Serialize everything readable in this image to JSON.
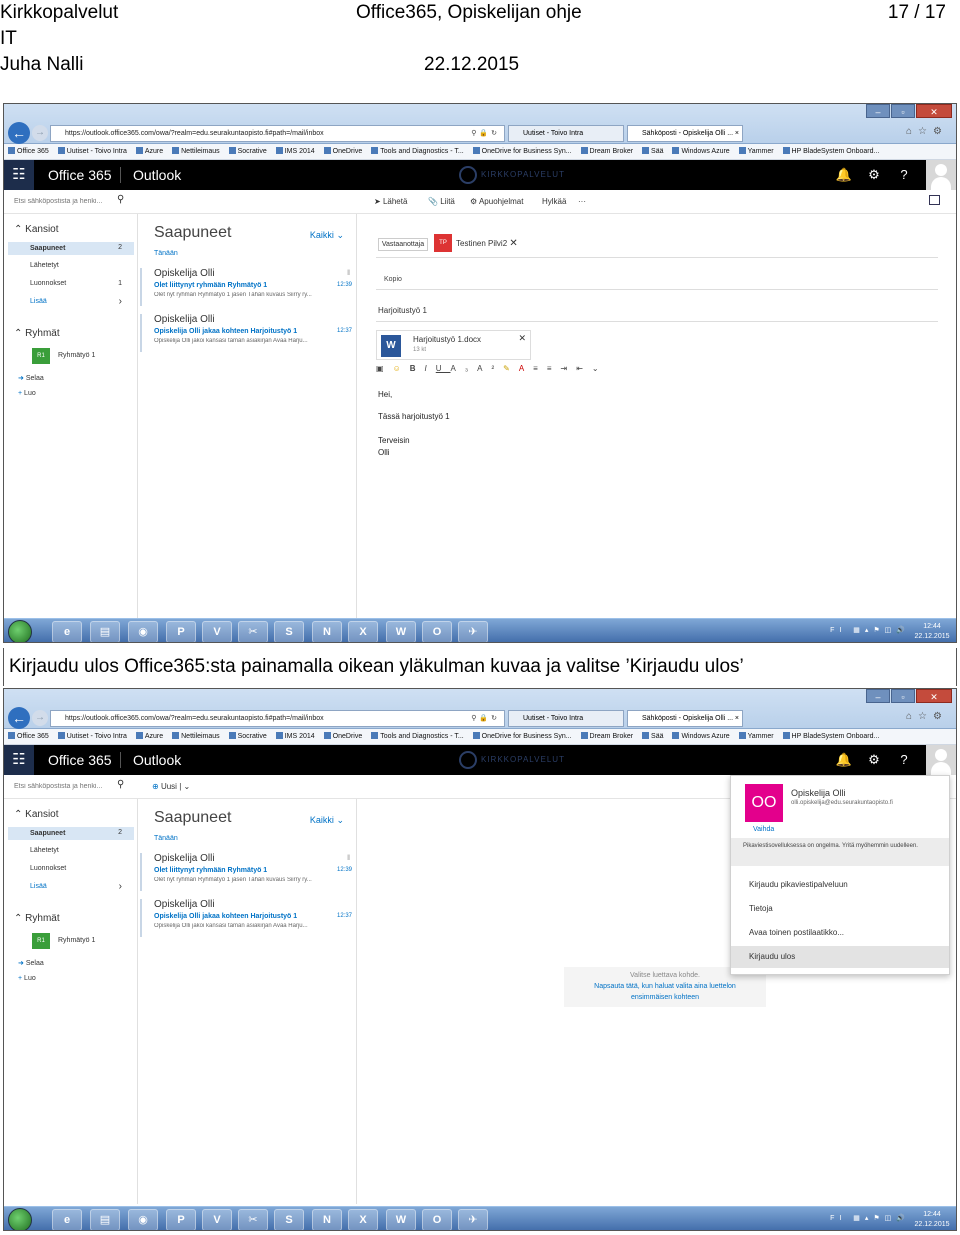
{
  "doc": {
    "org": "Kirkkopalvelut",
    "dept": "IT",
    "author": "Juha Nalli",
    "title": "Office365, Opiskelijan ohje",
    "date": "22.12.2015",
    "page": "17 / 17",
    "caption": "Kirjaudu ulos Office365:sta painamalla oikean yläkulman kuvaa ja valitse ’Kirjaudu ulos’"
  },
  "browser": {
    "url": "https://outlook.office365.com/owa/?realm=edu.seurakuntaopisto.fi#path=/mail/inbox",
    "tabs": [
      {
        "label": "Uutiset - Toivo Intra"
      },
      {
        "label": "Sähköposti - Opiskelija Olli ..."
      }
    ],
    "favorites": [
      "Office 365",
      "Uutiset - Toivo Intra",
      "Azure",
      "Nettileimaus",
      "Socrative",
      "IMS 2014",
      "OneDrive",
      "Tools and Diagnostics - T...",
      "OneDrive for Business Syn...",
      "Dream Broker",
      "Sää",
      "Windows Azure",
      "Yammer",
      "HP BladeSystem Onboard..."
    ],
    "window_buttons": {
      "minimize": "–",
      "maximize": "▫",
      "close": "✕"
    }
  },
  "o365": {
    "brand": "Office 365",
    "app": "Outlook",
    "org_logo": "KIRKKOPALVELUT"
  },
  "search": {
    "placeholder": "Etsi sähköpostista ja henki..."
  },
  "commands": {
    "send": "Lähetä",
    "attach": "Liitä",
    "addins": "Apuohjelmat",
    "discard": "Hylkää",
    "more": "···",
    "new": "Uusi"
  },
  "folders": {
    "header": "Kansiot",
    "items": [
      {
        "label": "Saapuneet",
        "count": "2"
      },
      {
        "label": "Lähetetyt",
        "count": ""
      },
      {
        "label": "Luonnokset",
        "count": "1"
      },
      {
        "label": "Lisää",
        "count": ""
      }
    ],
    "groups_header": "Ryhmät",
    "group": {
      "badge": "R1",
      "label": "Ryhmätyö 1"
    },
    "browse": "Selaa",
    "create": "Luo"
  },
  "list": {
    "title": "Saapuneet",
    "filter": "Kaikki",
    "today": "Tänään",
    "messages": [
      {
        "from": "Opiskelija Olli",
        "subject": "Olet liittynyt ryhmään Ryhmätyö 1",
        "time": "12:39",
        "preview": "Olet nyt ryhmän Ryhmätyö 1 jäsen Tähän kuvaus Siirry ry..."
      },
      {
        "from": "Opiskelija Olli",
        "subject": "Opiskelija Olli jakaa kohteen Harjoitustyö 1",
        "time": "12:37",
        "preview": "Opiskelija Olli jakoi kansasi tämän asiakirjan Avaa Harju..."
      }
    ]
  },
  "compose": {
    "to_label": "Vastaanottaja",
    "recipient_badge": "TP",
    "recipient": "Testinen Pilvi2",
    "cc_label": "Kopio",
    "subject": "Harjoitustyö 1",
    "attachment_name": "Harjoitustyö 1.docx",
    "attachment_size": "13 kt",
    "body": [
      "Hei,",
      "Tässä harjoitustyö 1",
      "Terveisin",
      "Olli"
    ]
  },
  "account": {
    "initials": "OO",
    "change": "Vaihda",
    "name": "Opiskelija Olli",
    "email": "olli.opiskelija@edu.seurakuntaopisto.fi",
    "notice": "Pikaviestisovelluksessa on ongelma. Yritä myöhemmin uudelleen.",
    "options": [
      "Kirjaudu pikaviestipalveluun",
      "Tietoja",
      "Avaa toinen postilaatikko...",
      "Kirjaudu ulos"
    ]
  },
  "reading_pane": {
    "line1": "Valitse luettava kohde.",
    "line2": "Napsauta tätä, kun haluat valita aina luettelon",
    "line3": "ensimmäisen kohteen"
  },
  "taskbar": {
    "apps": [
      "e",
      "▤",
      "◉",
      "P",
      "V",
      "✂",
      "S",
      "N",
      "X",
      "W",
      "O",
      "✈"
    ],
    "tray_lang": "FI",
    "time": "12:44",
    "date": "22.12.2015"
  },
  "colors": {
    "o365_header": "#000000",
    "accent_blue": "#0072c6",
    "avatar_pink": "#e3008c",
    "word_blue": "#2b579a",
    "recipient_red": "#dd3333"
  }
}
